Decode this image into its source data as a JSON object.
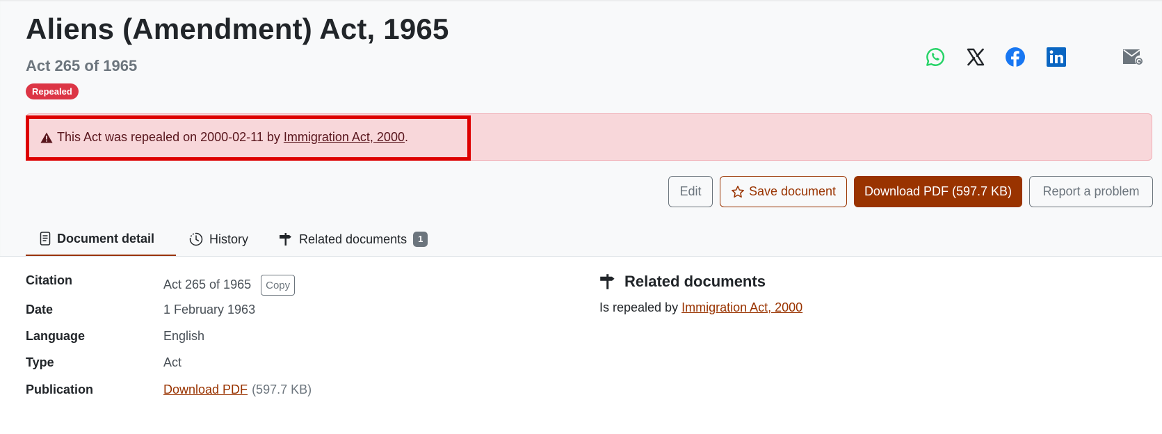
{
  "header": {
    "title": "Aliens (Amendment) Act, 1965",
    "subtitle": "Act 265 of 1965",
    "status_badge": "Repealed"
  },
  "share": {
    "icons": [
      "whatsapp-icon",
      "x-icon",
      "facebook-icon",
      "linkedin-icon",
      "email-icon"
    ]
  },
  "alert": {
    "text_before": "This Act was repealed on 2000-02-11 by ",
    "link": "Immigration Act, 2000",
    "text_after": "."
  },
  "toolbar": {
    "edit_label": "Edit",
    "save_label": "Save document",
    "download_label": "Download PDF (597.7 KB)",
    "report_label": "Report a problem"
  },
  "tabs": [
    {
      "label": "Document detail",
      "active": true
    },
    {
      "label": "History",
      "active": false
    },
    {
      "label": "Related documents",
      "count": "1",
      "active": false
    }
  ],
  "details": {
    "citation_label": "Citation",
    "citation_value": "Act 265 of 1965",
    "copy_label": "Copy",
    "date_label": "Date",
    "date_value": "1 February 1963",
    "language_label": "Language",
    "language_value": "English",
    "type_label": "Type",
    "type_value": "Act",
    "publication_label": "Publication",
    "publication_link": "Download PDF",
    "publication_size": "(597.7 KB)"
  },
  "related": {
    "heading": "Related documents",
    "relation_text": "Is repealed by ",
    "relation_link": "Immigration Act, 2000"
  },
  "colors": {
    "brand": "#993300",
    "danger": "#dc3545",
    "alert_bg": "#f8d7da",
    "highlight": "#dd0000",
    "whatsapp": "#25d366",
    "facebook": "#1877f2",
    "linkedin": "#0a66c2"
  }
}
